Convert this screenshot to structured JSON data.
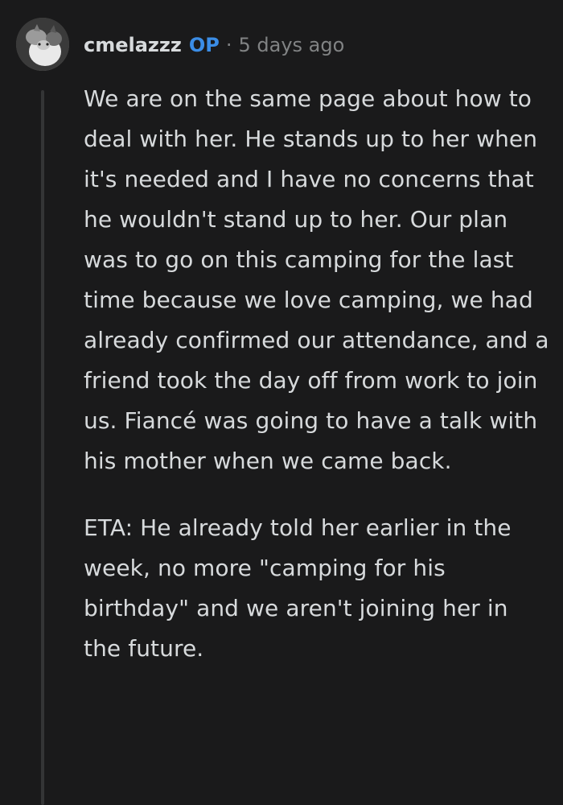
{
  "comment": {
    "username": "cmelazzz",
    "op_badge": "OP",
    "separator": "·",
    "timestamp": "5 days ago",
    "avatar_icon": "cat-photo-avatar",
    "paragraphs": [
      "We are on the same page about how to deal with her. He stands up to her when it's needed and I have no concerns that he wouldn't stand up to her. Our plan was to go on this camping for the last time because we love camping, we had already confirmed our attendance, and a friend took the day off from work to join us. Fiancé was going to have a talk with his mother when we came back.",
      "ETA: He already told her earlier in the week, no more \"camping for his birthday\" and we aren't joining her in the future."
    ]
  },
  "colors": {
    "background": "#1a1a1b",
    "text": "#d7dadc",
    "op_accent": "#3b8de6",
    "muted": "#818384",
    "thread_line": "#343536"
  }
}
